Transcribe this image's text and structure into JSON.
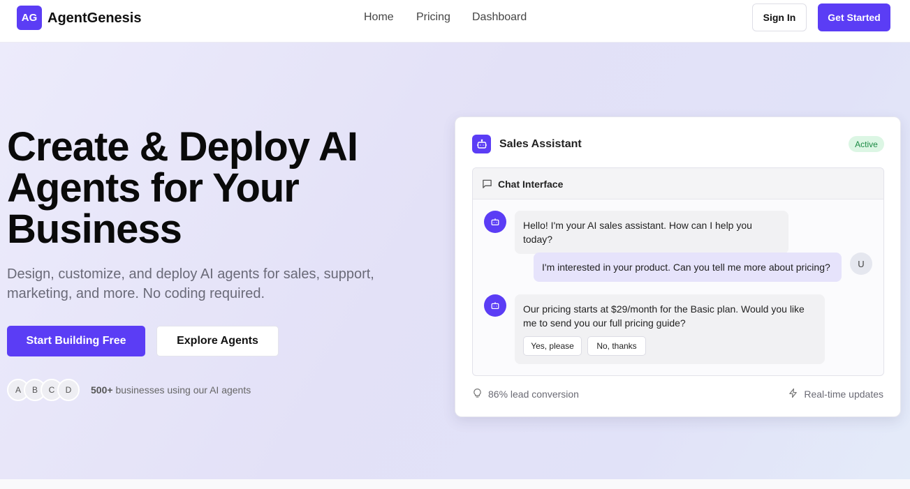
{
  "nav": {
    "logo_mark": "AG",
    "brand": "AgentGenesis",
    "links": [
      "Home",
      "Pricing",
      "Dashboard"
    ],
    "sign_in": "Sign In",
    "get_started": "Get Started"
  },
  "hero": {
    "title_lines": [
      "Create & Deploy AI",
      "Agents for Your",
      "Business"
    ],
    "subtitle_lines": [
      "Design, customize, and deploy AI agents for sales, support,",
      "marketing, and more. No coding required."
    ],
    "primary_cta": "Start Building Free",
    "secondary_cta": "Explore Agents",
    "avatars": [
      "A",
      "B",
      "C",
      "D"
    ],
    "social_count": "500+",
    "social_text": "businesses using our AI agents"
  },
  "card": {
    "title": "Sales Assistant",
    "status": "Active",
    "chat_title": "Chat Interface",
    "messages": [
      {
        "from": "bot",
        "text": "Hello! I'm your AI sales assistant. How can I help you today?"
      },
      {
        "from": "user",
        "avatar": "U",
        "text": "I'm interested in your product. Can you tell me more about pricing?"
      },
      {
        "from": "bot",
        "text_lines": [
          "Our pricing starts at $29/month for the Basic plan. Would you like",
          "me to send you our full pricing guide?"
        ],
        "quick_replies": [
          "Yes, please",
          "No, thanks"
        ]
      }
    ],
    "footer_left": "86% lead conversion",
    "footer_right": "Real-time updates"
  },
  "colors": {
    "brand": "#5b3df5",
    "badge_bg": "#dcf6e4",
    "badge_text": "#1c8a44"
  }
}
